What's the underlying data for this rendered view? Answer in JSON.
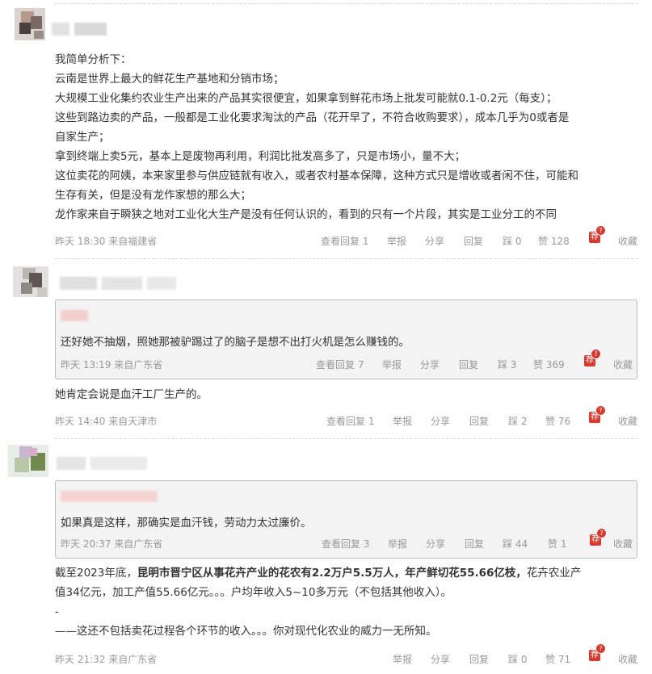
{
  "comment1": {
    "lines": [
      "我简单分析下：",
      "云南是世界上最大的鲜花生产基地和分销市场；",
      "大规模工业化集约农业生产出来的产品其实很便宜，如果拿到鲜花市场上批发可能就0.1-0.2元（每支）；",
      "这些到路边卖的产品，一般都是工业化要求淘汰的产品（花开早了，不符合收购要求），成本几乎为0或者是",
      "自家生产；",
      "拿到终端上卖5元，基本上是废物再利用，利润比批发高多了，只是市场小，量不大；",
      "这位卖花的阿姨，本来家里参与供应链就有收入，或者农村基本保障，这种方式只是增收或者闲不住，可能和",
      "生存有关，但是没有龙作家想的那么大；",
      "龙作家来自于瞬狭之地对工业化大生产是没有任何认识的，看到的只有一个片段，其实是工业分工的不同"
    ],
    "meta": {
      "time": "昨天 18:30  来自福建省",
      "view_replies": "查看回复 1",
      "report": "举报",
      "share": "分享",
      "reply": "回复",
      "dislike": "踩 0",
      "like": "赞 128",
      "rec": "荐",
      "fav": "收藏"
    }
  },
  "comment2": {
    "quote_text": "还好她不抽烟，照她那被驴踢过了的脑子是想不出打火机是怎么赚钱的。",
    "quote_meta": {
      "time": "昨天 13:19  来自广东省",
      "view_replies": "查看回复 7",
      "report": "举报",
      "share": "分享",
      "reply": "回复",
      "dislike": "踩 3",
      "like": "赞 369",
      "rec": "荐",
      "fav": "收藏"
    },
    "text": "她肯定会说是血汗工厂生产的。",
    "meta": {
      "time": "昨天 14:40  来自天津市",
      "view_replies": "查看回复 1",
      "report": "举报",
      "share": "分享",
      "reply": "回复",
      "dislike": "踩 2",
      "like": "赞 76",
      "rec": "荐",
      "fav": "收藏"
    }
  },
  "comment3": {
    "quote_text": "如果真是这样，那确实是血汗钱，劳动力太过廉价。",
    "quote_meta": {
      "time": "昨天 20:37  来自广东省",
      "view_replies": "查看回复 3",
      "report": "举报",
      "share": "分享",
      "reply": "回复",
      "dislike": "踩 44",
      "like": "赞 1",
      "rec": "荐",
      "fav": "收藏"
    },
    "line1_a": "截至2023年底，",
    "line1_b": "昆明市晋宁区从事花卉产业的花农有2.2万户5.5万人，年产鲜切花55.66亿枝，",
    "line1_c": "花卉农业产",
    "line2": "值34亿元，加工产值55.66亿元。。。户均年收入5~10多万元（不包括其他收入）。",
    "line3": "-",
    "line4": "——这还不包括卖花过程各个环节的收入。。。你对现代化农业的威力一无所知。",
    "meta": {
      "time": "昨天 21:32  来自广东省",
      "report": "举报",
      "share": "分享",
      "reply": "回复",
      "dislike": "踩 0",
      "like": "赞 71",
      "rec": "荐",
      "fav": "收藏"
    }
  }
}
